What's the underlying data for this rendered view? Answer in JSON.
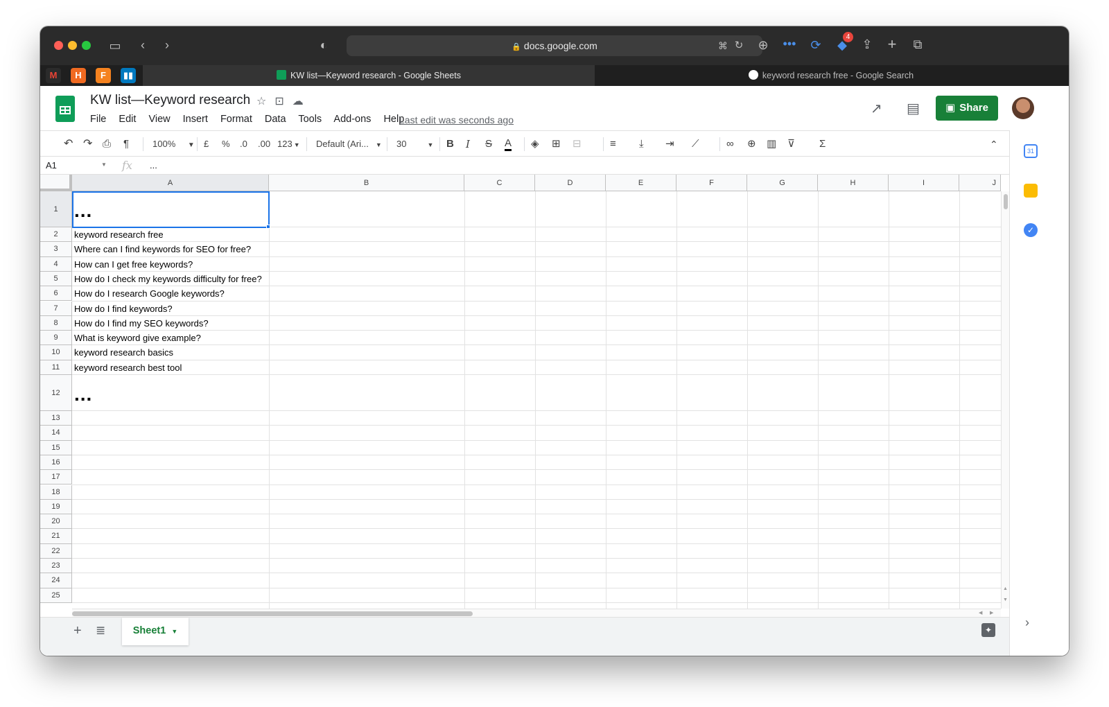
{
  "browser": {
    "url": "docs.google.com",
    "badge_count": "4",
    "tabs": [
      {
        "title": "KW list—Keyword research - Google Sheets",
        "active": true
      },
      {
        "title": "keyword research free - Google Search",
        "active": false
      }
    ],
    "pinned": [
      {
        "letter": "M",
        "color": "#2b2b2b"
      },
      {
        "letter": "H",
        "color": "#f06a21"
      },
      {
        "letter": "F",
        "color": "#f5821f"
      },
      {
        "letter": "",
        "color": "#0079bf"
      }
    ]
  },
  "doc": {
    "title": "KW list—Keyword research",
    "menu": [
      "File",
      "Edit",
      "View",
      "Insert",
      "Format",
      "Data",
      "Tools",
      "Add-ons",
      "Help"
    ],
    "last_edit": "Last edit was seconds ago",
    "share_label": "Share"
  },
  "toolbar": {
    "zoom": "100%",
    "currency": "£",
    "percent": "%",
    "dec_less": ".0",
    "dec_more": ".00",
    "more_formats": "123",
    "font": "Default (Ari...",
    "font_size": "30",
    "bold": "B",
    "italic": "I",
    "strike": "S",
    "text_color": "A"
  },
  "formula_bar": {
    "cell_ref": "A1",
    "fx": "fx",
    "value": "..."
  },
  "grid": {
    "columns": [
      "A",
      "B",
      "C",
      "D",
      "E",
      "F",
      "G",
      "H",
      "I",
      "J"
    ],
    "rows": [
      "1",
      "2",
      "3",
      "4",
      "5",
      "6",
      "7",
      "8",
      "9",
      "10",
      "11",
      "12",
      "13",
      "14",
      "15",
      "16",
      "17",
      "18",
      "19",
      "20",
      "21",
      "22",
      "23",
      "24",
      "25"
    ],
    "cells": [
      "...",
      "keyword research free",
      "Where can I find keywords for SEO for free?",
      "How can I get free keywords?",
      "How do I check my keywords difficulty for free?",
      "How do I research Google keywords?",
      "How do I find keywords?",
      "How do I find my SEO keywords?",
      "What is keyword give example?",
      "keyword research basics",
      "keyword research best tool",
      "..."
    ]
  },
  "sheets": [
    {
      "name": "Sheet1",
      "active": true
    }
  ],
  "colors": {
    "brand_green": "#188038",
    "selection_blue": "#1a73e8"
  }
}
